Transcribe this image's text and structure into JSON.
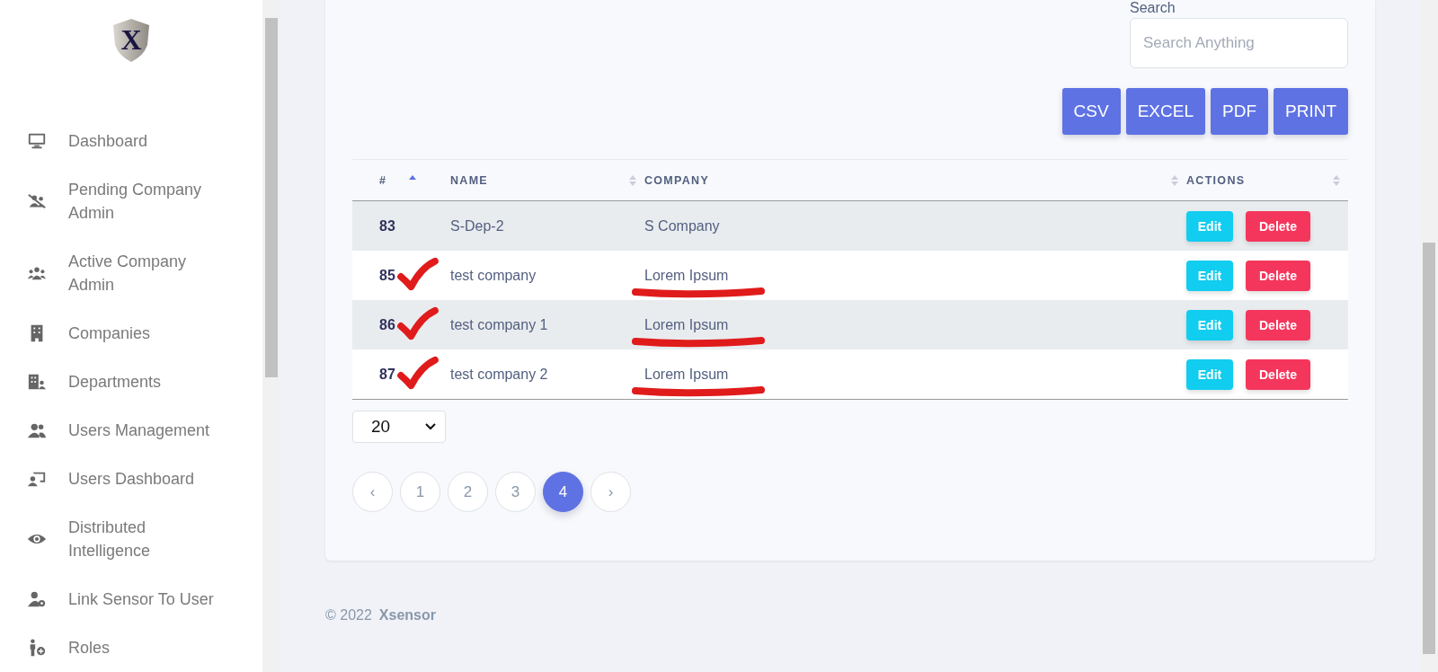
{
  "sidebar": {
    "logo": "X",
    "items": [
      {
        "label": "Dashboard"
      },
      {
        "label": "Pending Company Admin"
      },
      {
        "label": "Active Company Admin"
      },
      {
        "label": "Companies"
      },
      {
        "label": "Departments"
      },
      {
        "label": "Users Management"
      },
      {
        "label": "Users Dashboard"
      },
      {
        "label": "Distributed Intelligence"
      },
      {
        "label": "Link Sensor To User"
      },
      {
        "label": "Roles"
      }
    ]
  },
  "search": {
    "label": "Search",
    "placeholder": "Search Anything"
  },
  "export_buttons": [
    "CSV",
    "EXCEL",
    "PDF",
    "PRINT"
  ],
  "table": {
    "columns": [
      {
        "label": "#",
        "sorted": true
      },
      {
        "label": "NAME",
        "sorted": false
      },
      {
        "label": "COMPANY",
        "sorted": false
      },
      {
        "label": "ACTIONS",
        "sorted": false
      }
    ],
    "rows": [
      {
        "id": "83",
        "name": "S-Dep-2",
        "company": "S Company",
        "edit": "Edit",
        "delete": "Delete",
        "annotated": false
      },
      {
        "id": "85",
        "name": "test company",
        "company": "Lorem Ipsum",
        "edit": "Edit",
        "delete": "Delete",
        "annotated": true
      },
      {
        "id": "86",
        "name": "test company 1",
        "company": "Lorem Ipsum",
        "edit": "Edit",
        "delete": "Delete",
        "annotated": true
      },
      {
        "id": "87",
        "name": "test company 2",
        "company": "Lorem Ipsum",
        "edit": "Edit",
        "delete": "Delete",
        "annotated": true
      }
    ]
  },
  "page_size": "20",
  "pagination": [
    {
      "label": "‹",
      "selected": false
    },
    {
      "label": "1",
      "selected": false
    },
    {
      "label": "2",
      "selected": false
    },
    {
      "label": "3",
      "selected": false
    },
    {
      "label": "4",
      "selected": true
    },
    {
      "label": "›",
      "selected": false
    }
  ],
  "footer": {
    "copyright": "© 2022",
    "brand": "Xsensor"
  }
}
